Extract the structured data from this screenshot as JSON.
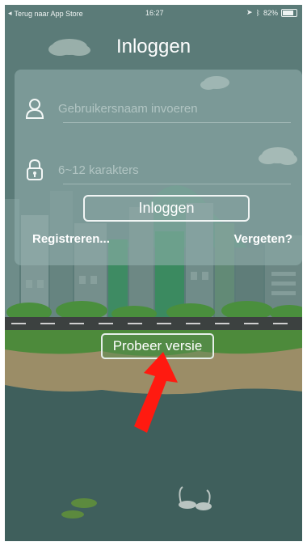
{
  "status_bar": {
    "back_label": "Terug naar App Store",
    "time": "16:27",
    "battery_text": "82%",
    "battery_level": 0.82
  },
  "header": {
    "title": "Inloggen"
  },
  "form": {
    "username_placeholder": "Gebruikersnaam invoeren",
    "password_placeholder": "6~12 karakters",
    "login_button": "Inloggen",
    "register_link": "Registreren...",
    "forgot_link": "Vergeten?"
  },
  "trial_button": "Probeer versie",
  "colors": {
    "accent_arrow": "#ff1a10",
    "sky": "#5b7b78",
    "water": "#3f5f5c",
    "card": "#96b2b0"
  },
  "icons": [
    "back-arrow-icon",
    "location-icon",
    "bluetooth-icon",
    "battery-icon",
    "user-icon",
    "lock-icon",
    "pointer-arrow-icon"
  ]
}
